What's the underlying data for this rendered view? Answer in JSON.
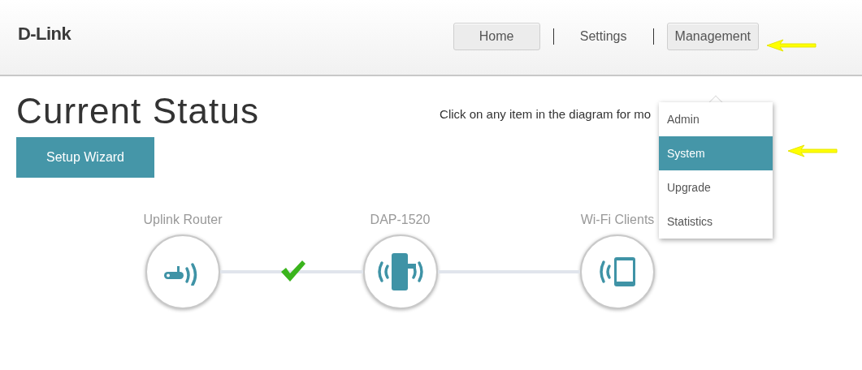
{
  "logo": "D-Link",
  "nav": [
    {
      "label": "Home",
      "selected": true
    },
    {
      "label": "Settings",
      "selected": false
    },
    {
      "label": "Management",
      "selected": true
    }
  ],
  "dropdown": {
    "expanded": true,
    "items": [
      {
        "label": "Admin",
        "selected": false
      },
      {
        "label": "System",
        "selected": true
      },
      {
        "label": "Upgrade",
        "selected": false
      },
      {
        "label": "Statistics",
        "selected": false
      }
    ]
  },
  "page_title": "Current Status",
  "hint": "Click on any item in the diagram for mo",
  "setup_button": "Setup Wizard",
  "diagram": {
    "nodes": [
      {
        "kind": "router",
        "label": "Uplink Router"
      },
      {
        "kind": "extender",
        "label": "DAP-1520"
      },
      {
        "kind": "clients",
        "label": "Wi-Fi Clients"
      }
    ],
    "links": [
      {
        "connected": true
      },
      {
        "connected": false
      }
    ]
  }
}
